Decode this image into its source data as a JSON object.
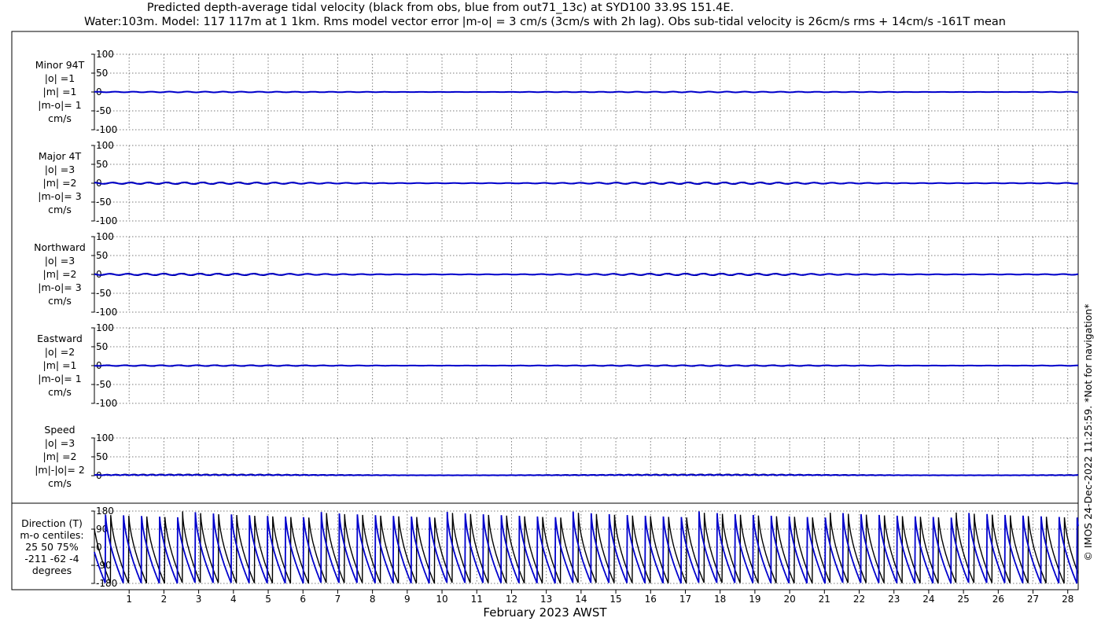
{
  "title_line1": "Predicted depth-average tidal velocity (black from obs, blue from out71_13c) at SYD100 33.9S 151.4E.",
  "title_line2": "Water:103m. Model: 117 117m at 1 1km. Rms model vector error |m-o| = 3 cm/s (3cm/s with 2h lag). Obs sub-tidal velocity is 26cm/s rms + 14cm/s -161T mean",
  "side_note": "© IMOS 24-Dec-2022 11:25:59.  *Not for navigation*",
  "colors": {
    "obs": "#000000",
    "model": "#0000cc",
    "grid": "#7a7a7a"
  },
  "chart_data": {
    "type": "line",
    "xlabel": "February 2023 AWST",
    "x_tick_labels": [
      "1",
      "2",
      "3",
      "4",
      "5",
      "6",
      "7",
      "8",
      "9",
      "10",
      "11",
      "12",
      "13",
      "14",
      "15",
      "16",
      "17",
      "18",
      "19",
      "20",
      "21",
      "22",
      "23",
      "24",
      "25",
      "26",
      "27",
      "28"
    ],
    "xlim": [
      0.0,
      28.3
    ],
    "grid": true,
    "series_names": [
      "obs",
      "out71_13c"
    ],
    "panels": [
      {
        "label": [
          "Minor 94T",
          "|o| =1",
          "|m| =1",
          "|m-o|= 1",
          "cm/s"
        ],
        "ylim": [
          -100,
          100
        ],
        "yticks": [
          "100",
          "50",
          "0",
          "-50",
          "-100"
        ],
        "yvals": [
          100,
          50,
          0,
          -50,
          -100
        ],
        "obs_amplitude": 1,
        "model_amplitude": 1
      },
      {
        "label": [
          "Major 4T",
          "|o| =3",
          "|m| =2",
          "|m-o|= 3",
          "cm/s"
        ],
        "ylim": [
          -100,
          100
        ],
        "yticks": [
          "100",
          "50",
          "0",
          "-50",
          "-100"
        ],
        "yvals": [
          100,
          50,
          0,
          -50,
          -100
        ],
        "obs_amplitude": 3,
        "model_amplitude": 2
      },
      {
        "label": [
          "Northward",
          "|o| =3",
          "|m| =2",
          "|m-o|= 3",
          "cm/s"
        ],
        "ylim": [
          -100,
          100
        ],
        "yticks": [
          "100",
          "50",
          "0",
          "-50",
          "-100"
        ],
        "yvals": [
          100,
          50,
          0,
          -50,
          -100
        ],
        "obs_amplitude": 3,
        "model_amplitude": 2
      },
      {
        "label": [
          "Eastward",
          "|o| =2",
          "|m| =1",
          "|m-o|= 1",
          "cm/s"
        ],
        "ylim": [
          -100,
          100
        ],
        "yticks": [
          "100",
          "50",
          "0",
          "-50",
          "-100"
        ],
        "yvals": [
          100,
          50,
          0,
          -50,
          -100
        ],
        "obs_amplitude": 2,
        "model_amplitude": 1
      },
      {
        "label": [
          "Speed",
          "|o| =3",
          "|m| =2",
          "|m|-|o|= 2",
          "cm/s"
        ],
        "ylim": [
          0,
          100
        ],
        "yticks": [
          "100",
          "50",
          "0"
        ],
        "yvals": [
          100,
          50,
          0
        ],
        "obs_amplitude": 3,
        "model_amplitude": 2
      }
    ],
    "direction_panel": {
      "label": [
        "Direction (T)",
        "m-o centiles:",
        "25  50  75%",
        "-211  -62   -4",
        "degrees"
      ],
      "ylim": [
        -180,
        180
      ],
      "yticks": [
        "180",
        "90",
        "0",
        "-90",
        "-180"
      ],
      "yvals": [
        180,
        90,
        0,
        -90,
        -180
      ],
      "tidal_period_days": 0.5175
    }
  }
}
